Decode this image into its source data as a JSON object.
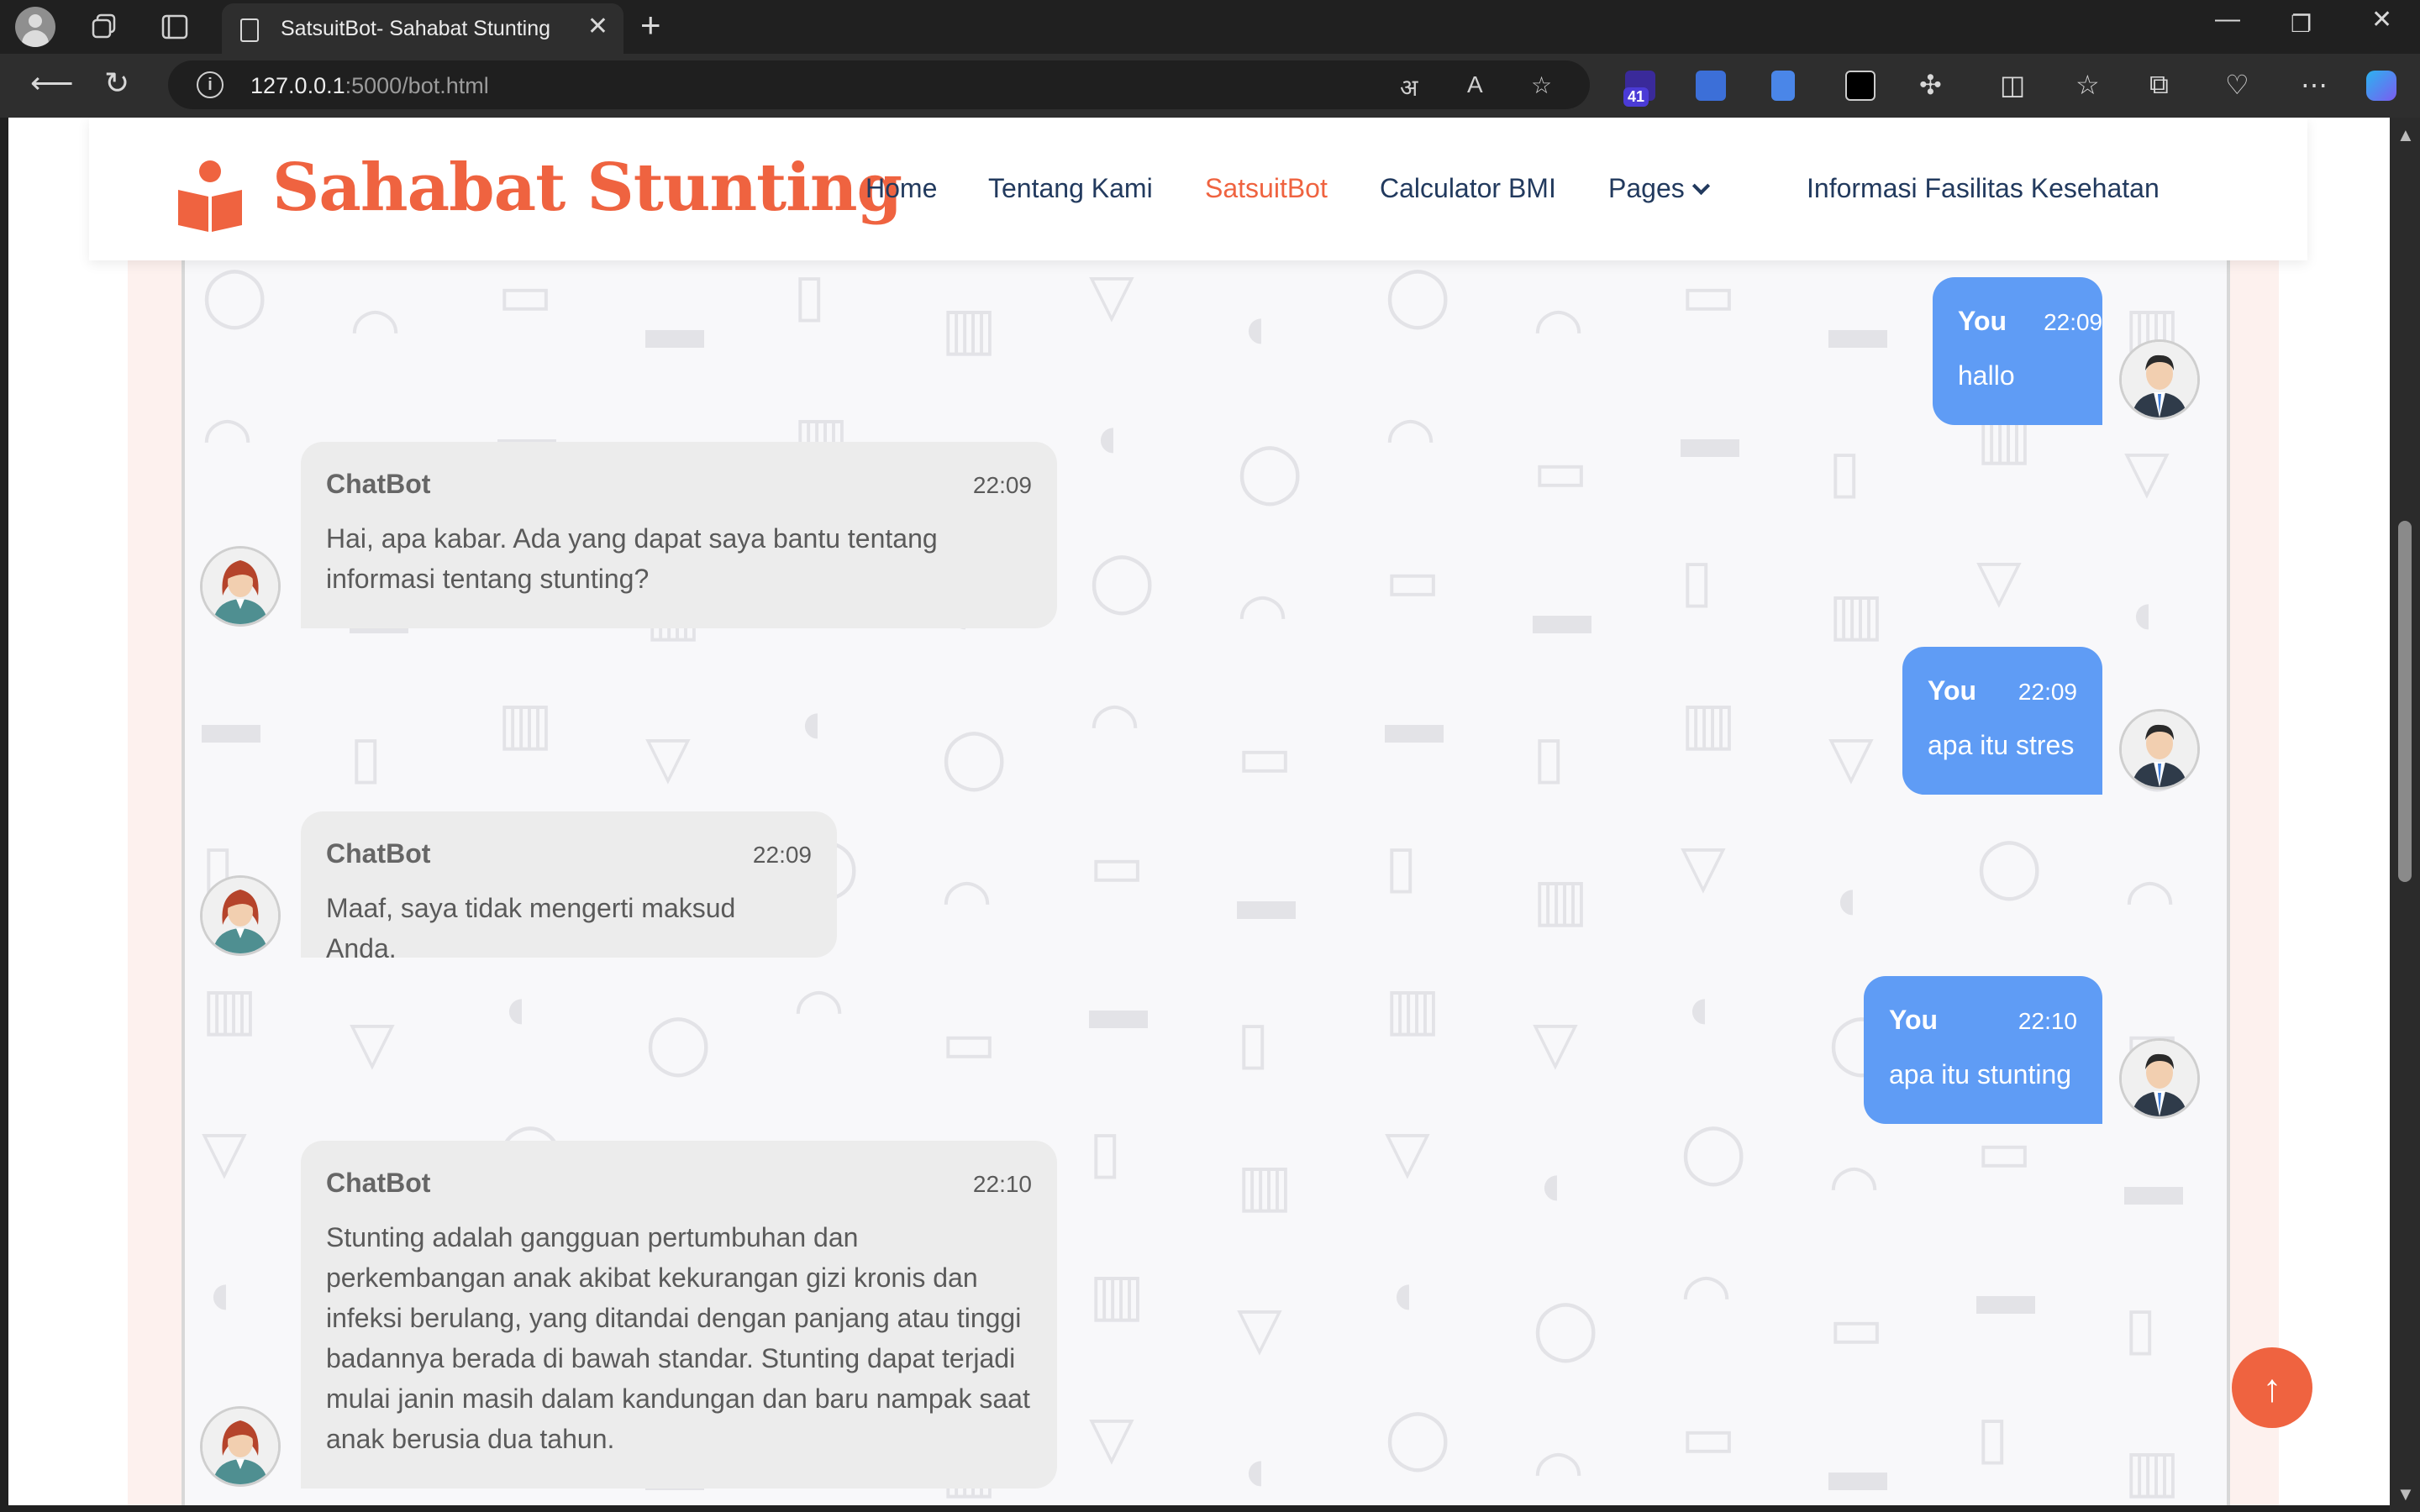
{
  "browser": {
    "tab_title": "SatsuitBot- Sahabat Stunting",
    "url_host": "127.0.0.1",
    "url_rest": ":5000/bot.html",
    "extension_badge": "41"
  },
  "site": {
    "brand": "Sahabat Stunting",
    "nav": [
      "Home",
      "Tentang Kami",
      "SatsuitBot",
      "Calculator BMI",
      "Pages",
      "Informasi Fasilitas Kesehatan"
    ],
    "active_nav": "SatsuitBot",
    "brand_color": "#ef6340"
  },
  "chat": {
    "user_color": "#5f9cf5",
    "bot_color": "#ececec",
    "messages": [
      {
        "sender": "You",
        "time": "22:09",
        "text": "hallo"
      },
      {
        "sender": "ChatBot",
        "time": "22:09",
        "text": "Hai, apa kabar. Ada yang dapat saya bantu tentang informasi tentang stunting?"
      },
      {
        "sender": "You",
        "time": "22:09",
        "text": "apa itu stres"
      },
      {
        "sender": "ChatBot",
        "time": "22:09",
        "text": "Maaf, saya tidak mengerti maksud Anda."
      },
      {
        "sender": "You",
        "time": "22:10",
        "text": "apa itu stunting"
      },
      {
        "sender": "ChatBot",
        "time": "22:10",
        "text": "Stunting adalah gangguan pertumbuhan dan perkembangan anak akibat kekurangan gizi kronis dan infeksi berulang, yang ditandai dengan panjang atau tinggi badannya berada di bawah standar. Stunting dapat terjadi mulai janin masih dalam kandungan dan baru nampak saat anak berusia dua tahun."
      }
    ]
  },
  "icons": {
    "back_to_top": "arrow-up-icon"
  }
}
